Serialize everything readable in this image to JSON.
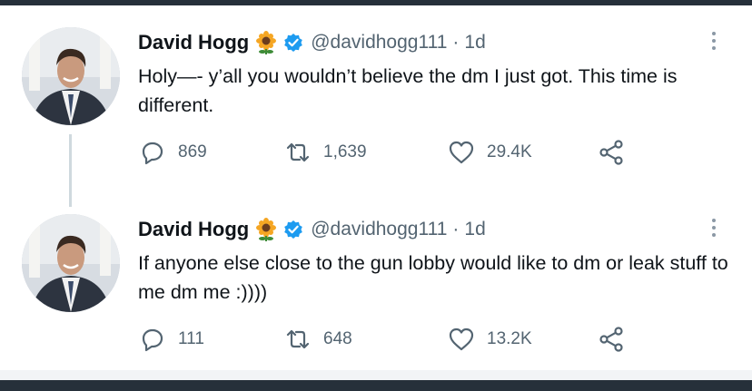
{
  "tweets": [
    {
      "author_name": "David Hogg",
      "emoji": "sunflower",
      "verified": true,
      "handle": "@davidhogg111",
      "separator": "·",
      "time": "1d",
      "text": "Holy—-  y’all you wouldn’t believe the dm I just got. This time is different.",
      "reply_count": "869",
      "retweet_count": "1,639",
      "like_count": "29.4K",
      "icons": {
        "reply": "reply-icon",
        "retweet": "retweet-icon",
        "like": "heart-icon",
        "share": "share-icon",
        "more": "more-vertical-icon"
      }
    },
    {
      "author_name": "David Hogg",
      "emoji": "sunflower",
      "verified": true,
      "handle": "@davidhogg111",
      "separator": "·",
      "time": "1d",
      "text": "If anyone else close to the gun lobby would like to dm or leak stuff to me dm me :))))",
      "reply_count": "111",
      "retweet_count": "648",
      "like_count": "13.2K",
      "icons": {
        "reply": "reply-icon",
        "retweet": "retweet-icon",
        "like": "heart-icon",
        "share": "share-icon",
        "more": "more-vertical-icon"
      }
    }
  ],
  "colors": {
    "text_primary": "#0f1419",
    "text_secondary": "#536471",
    "verified_blue": "#1d9bf0",
    "thread_line": "#cfd9de",
    "background_frame": "#26303a"
  }
}
